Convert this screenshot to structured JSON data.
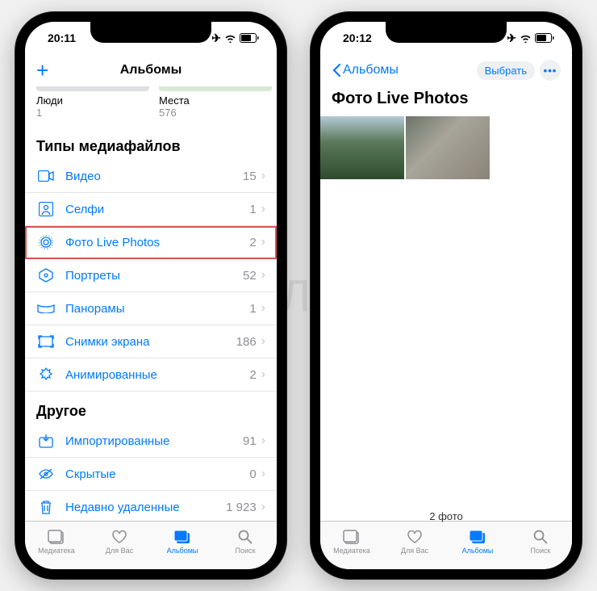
{
  "watermark": "ЯБЛЫК",
  "left": {
    "status_time": "20:11",
    "nav_title": "Альбомы",
    "albums_strip": [
      {
        "label": "Люди",
        "count": "1"
      },
      {
        "label": "Места",
        "count": "576"
      }
    ],
    "section_media": "Типы медиафайлов",
    "media_rows": [
      {
        "icon": "video-icon",
        "label": "Видео",
        "count": "15"
      },
      {
        "icon": "selfie-icon",
        "label": "Селфи",
        "count": "1"
      },
      {
        "icon": "livephoto-icon",
        "label": "Фото Live Photos",
        "count": "2",
        "highlight": true
      },
      {
        "icon": "portrait-icon",
        "label": "Портреты",
        "count": "52"
      },
      {
        "icon": "panorama-icon",
        "label": "Панорамы",
        "count": "1"
      },
      {
        "icon": "screenshot-icon",
        "label": "Снимки экрана",
        "count": "186"
      },
      {
        "icon": "animated-icon",
        "label": "Анимированные",
        "count": "2"
      }
    ],
    "section_other": "Другое",
    "other_rows": [
      {
        "icon": "import-icon",
        "label": "Импортированные",
        "count": "91"
      },
      {
        "icon": "hidden-icon",
        "label": "Скрытые",
        "count": "0"
      },
      {
        "icon": "trash-icon",
        "label": "Недавно удаленные",
        "count": "1 923"
      }
    ],
    "tabs": [
      {
        "icon": "library-icon",
        "label": "Медиатека"
      },
      {
        "icon": "foryou-icon",
        "label": "Для Вас"
      },
      {
        "icon": "albums-icon",
        "label": "Альбомы",
        "active": true
      },
      {
        "icon": "search-icon",
        "label": "Поиск"
      }
    ]
  },
  "right": {
    "status_time": "20:12",
    "back_label": "Альбомы",
    "select_label": "Выбрать",
    "page_title": "Фото Live Photos",
    "footer_count": "2 фото",
    "tabs": [
      {
        "icon": "library-icon",
        "label": "Медиатека"
      },
      {
        "icon": "foryou-icon",
        "label": "Для Вас"
      },
      {
        "icon": "albums-icon",
        "label": "Альбомы",
        "active": true
      },
      {
        "icon": "search-icon",
        "label": "Поиск"
      }
    ]
  }
}
